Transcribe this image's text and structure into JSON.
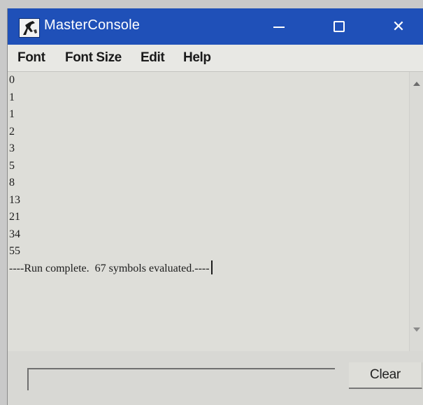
{
  "window": {
    "title": "MasterConsole",
    "controls": {
      "minimize": "—",
      "maximize": "□",
      "close": "✕"
    },
    "colors": {
      "titlebar": "#1f50b8",
      "background": "#dcdcd8"
    }
  },
  "menu": {
    "items": [
      "Font",
      "Font Size",
      "Edit",
      "Help"
    ]
  },
  "console": {
    "lines": [
      "0",
      "1",
      "1",
      "2",
      "3",
      "5",
      "8",
      "13",
      "21",
      "34",
      "55"
    ],
    "status": "----Run complete.  67 symbols evaluated.----"
  },
  "input": {
    "value": ""
  },
  "buttons": {
    "clear": "Clear"
  }
}
